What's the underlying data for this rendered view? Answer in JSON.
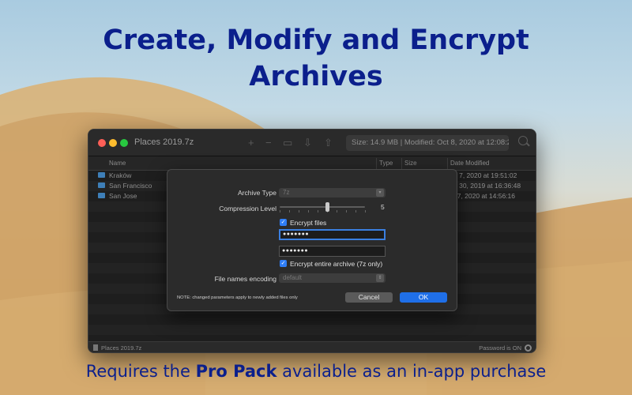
{
  "promo": {
    "headline_line1": "Create, Modify and Encrypt",
    "headline_line2": "Archives",
    "footer_before": "Requires the ",
    "footer_bold": "Pro Pack",
    "footer_after": " available as an in-app purchase"
  },
  "window": {
    "title": "Places 2019.7z",
    "info": "Size: 14.9 MB  |  Modified: Oct 8, 2020 at 12:08:22",
    "toolbar_icons": [
      "add-icon",
      "remove-icon",
      "folder-icon",
      "extract-icon",
      "export-icon",
      "search-icon"
    ]
  },
  "columns": {
    "name": "Name",
    "type": "Type",
    "size": "Size",
    "date": "Date Modified"
  },
  "rows": [
    {
      "name": "Kraków",
      "date": "p 7, 2020 at 19:51:02"
    },
    {
      "name": "San Francisco",
      "date": "p 30, 2019 at 16:36:48"
    },
    {
      "name": "San Jose",
      "date": "t 7, 2020 at 14:56:16"
    }
  ],
  "status": {
    "archive_name": "Places 2019.7z",
    "password_status": "Password is ON"
  },
  "dialog": {
    "archive_type_label": "Archive Type",
    "archive_type_value": "7z",
    "compression_label": "Compression Level",
    "compression_level": 5,
    "compression_min": 0,
    "compression_max": 9,
    "encrypt_files_label": "Encrypt files",
    "encrypt_files_checked": true,
    "password": "●●●●●●●",
    "password_confirm": "●●●●●●●",
    "encrypt_archive_label": "Encrypt entire archive (7z only)",
    "encrypt_archive_checked": true,
    "encoding_label": "File names encoding",
    "encoding_value": "default",
    "note": "NOTE: changed parameters apply to newly added files only",
    "cancel_label": "Cancel",
    "ok_label": "OK"
  },
  "colors": {
    "headline": "#0b1f8c",
    "accent": "#1f6fe8",
    "folder": "#3e7fb8"
  }
}
